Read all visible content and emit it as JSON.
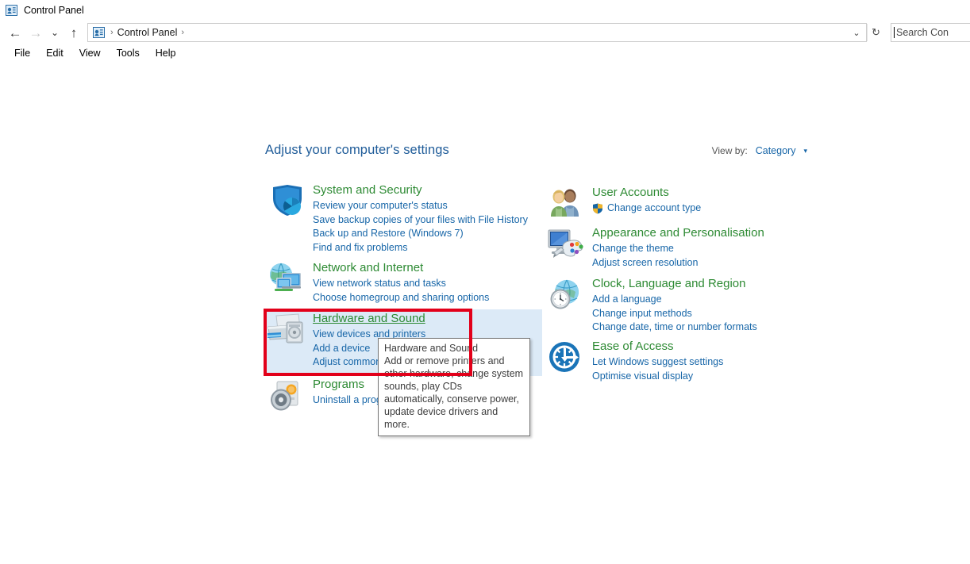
{
  "window": {
    "title": "Control Panel",
    "icon": "control-panel-icon"
  },
  "nav": {
    "back": "←",
    "forward": "→",
    "recent": "⌄",
    "up": "↑",
    "dropdown": "⌄",
    "refresh": "↻",
    "breadcrumb": {
      "root_icon": "control-panel-icon",
      "sep": "›",
      "items": [
        "Control Panel"
      ],
      "trailing_sep": "›"
    },
    "search": {
      "placeholder": "Search Con",
      "full_placeholder": "Search Control Panel"
    }
  },
  "menubar": {
    "items": [
      "File",
      "Edit",
      "View",
      "Tools",
      "Help"
    ]
  },
  "main": {
    "heading": "Adjust your computer's settings",
    "view_by": {
      "label": "View by:",
      "value": "Category",
      "caret": "▾"
    }
  },
  "categories": {
    "left": [
      {
        "id": "system-and-security",
        "icon": "shield-icon",
        "title": "System and Security",
        "hovered": false,
        "links": [
          "Review your computer's status",
          "Save backup copies of your files with File History",
          "Back up and Restore (Windows 7)",
          "Find and fix problems"
        ]
      },
      {
        "id": "network-and-internet",
        "icon": "network-globe-icon",
        "title": "Network and Internet",
        "hovered": false,
        "links": [
          "View network status and tasks",
          "Choose homegroup and sharing options"
        ]
      },
      {
        "id": "hardware-and-sound",
        "icon": "printer-icon",
        "title": "Hardware and Sound",
        "hovered": true,
        "links": [
          "View devices and printers",
          "Add a device",
          "Adjust commonly used mobility settings"
        ]
      },
      {
        "id": "programs",
        "icon": "programs-disc-icon",
        "title": "Programs",
        "hovered": false,
        "links": [
          "Uninstall a program"
        ]
      }
    ],
    "right": [
      {
        "id": "user-accounts",
        "icon": "users-icon",
        "title": "User Accounts",
        "links": [
          "Change account type"
        ],
        "shield_on_first_link": true
      },
      {
        "id": "appearance-and-personalisation",
        "icon": "monitor-palette-icon",
        "title": "Appearance and Personalisation",
        "links": [
          "Change the theme",
          "Adjust screen resolution"
        ],
        "shield_on_first_link": false
      },
      {
        "id": "clock-language-and-region",
        "icon": "clock-globe-icon",
        "title": "Clock, Language and Region",
        "links": [
          "Add a language",
          "Change input methods",
          "Change date, time or number formats"
        ],
        "shield_on_first_link": false
      },
      {
        "id": "ease-of-access",
        "icon": "ease-of-access-icon",
        "title": "Ease of Access",
        "links": [
          "Let Windows suggest settings",
          "Optimise visual display"
        ],
        "shield_on_first_link": false
      }
    ]
  },
  "tooltip": {
    "title": "Hardware and Sound",
    "body": "Add or remove printers and other hardware, change system sounds, play CDs automatically, conserve power, update device drivers and more."
  },
  "annotation": {
    "highlight_color": "#dceaf7",
    "box_color": "#e2001a"
  },
  "colors": {
    "category_title": "#2d8a33",
    "link": "#1766a8",
    "heading": "#1f5c99"
  }
}
